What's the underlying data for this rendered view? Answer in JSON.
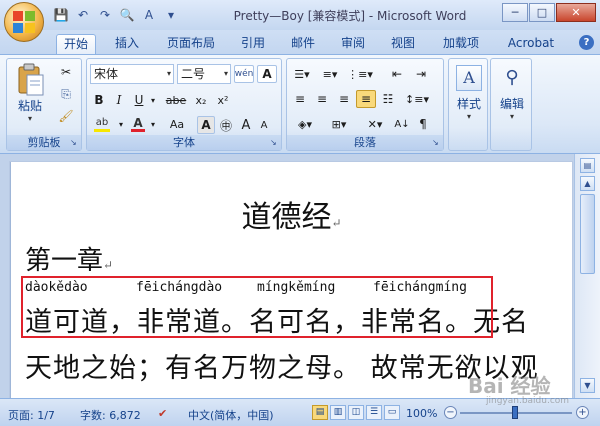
{
  "window": {
    "title": "Pretty—Boy [兼容模式] - Microsoft Word",
    "controls": {
      "minimize": "─",
      "maximize": "□",
      "close": "✕"
    }
  },
  "quick_access": [
    {
      "name": "save-icon",
      "glyph": "💾"
    },
    {
      "name": "undo-icon",
      "glyph": "↶"
    },
    {
      "name": "redo-icon",
      "glyph": "↷"
    },
    {
      "name": "print-preview-icon",
      "glyph": "🔍"
    },
    {
      "name": "spelling-icon",
      "glyph": "A"
    },
    {
      "name": "customize-icon",
      "glyph": "▾"
    }
  ],
  "tabs": [
    "开始",
    "插入",
    "页面布局",
    "引用",
    "邮件",
    "审阅",
    "视图",
    "加载项",
    "Acrobat"
  ],
  "help_label": "?",
  "clipboard": {
    "label": "剪贴板",
    "paste": "粘贴"
  },
  "font": {
    "label": "字体",
    "name": "宋体",
    "size": "二号",
    "bold": "B",
    "italic": "I",
    "underline": "U",
    "strike": "abe",
    "subscript": "x₂",
    "superscript": "x²",
    "grow": "A",
    "shrink": "A",
    "aa": "Aa"
  },
  "paragraph": {
    "label": "段落"
  },
  "styles": {
    "label": "样式"
  },
  "editing": {
    "label": "编辑"
  },
  "document": {
    "title": "道德经",
    "chapter": "第一章",
    "pinyin": [
      "dàokědào",
      "fēichángdào",
      "míngkěmíng",
      "fēichángmíng"
    ],
    "line1": "道可道，非常道。名可名，非常名。无名",
    "line2": "天地之始；有名万物之母。 故常无欲以观"
  },
  "status": {
    "page": "页面: 1/7",
    "words": "字数: 6,872",
    "language": "中文(简体，中国)",
    "zoom": "100%"
  },
  "watermark": {
    "main": "Bai 经验",
    "sub": "jingyan.baidu.com"
  },
  "colors": {
    "highlight_box": "#e0222c",
    "ribbon_text": "#15428b",
    "font_color_bar": "#e0222c",
    "highlight_color_bar": "#f7e700"
  }
}
